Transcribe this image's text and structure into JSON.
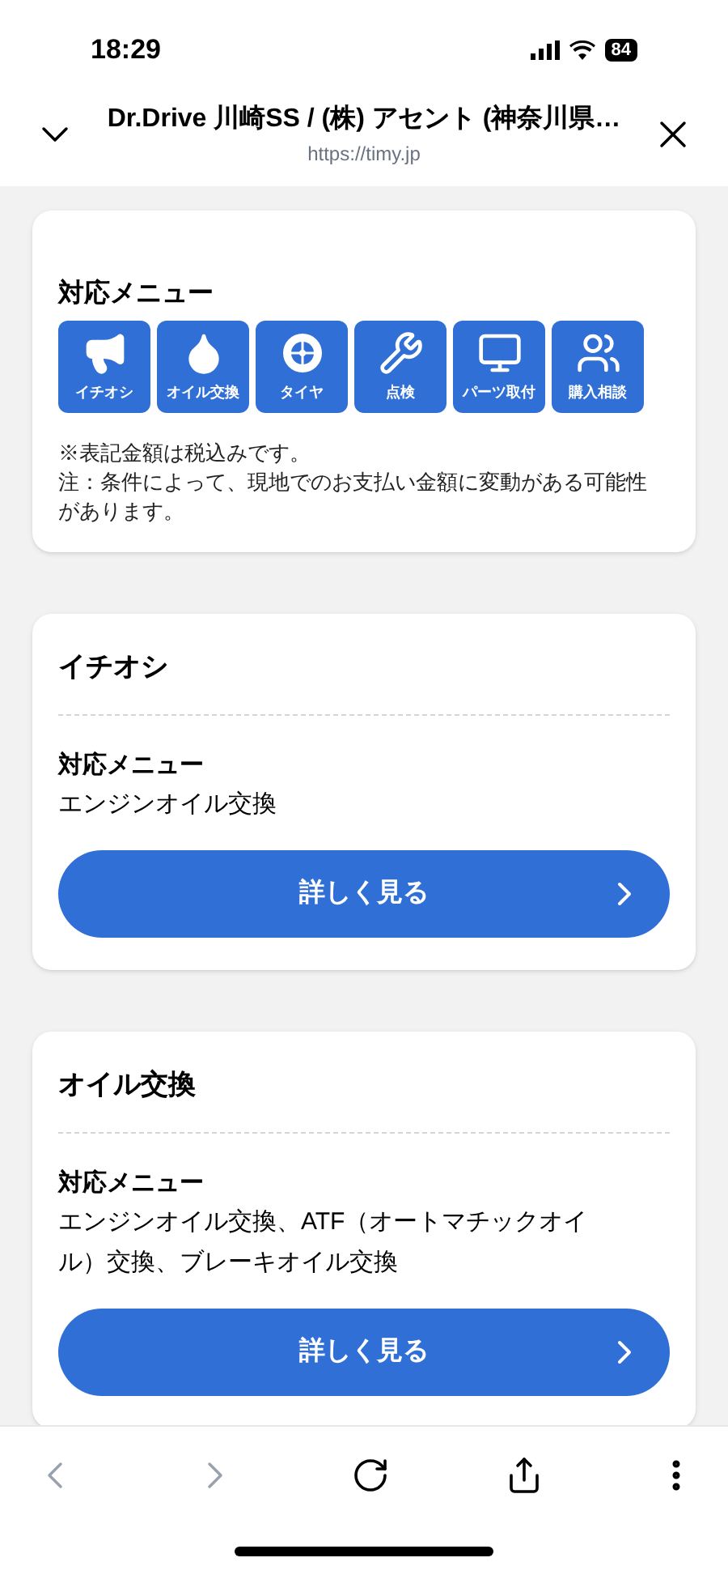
{
  "status_bar": {
    "time": "18:29",
    "battery": "84"
  },
  "header": {
    "title": "Dr.Drive 川崎SS / (株) アセント (神奈川県…",
    "url": "https://timy.jp"
  },
  "menu_card": {
    "heading": "対応メニュー",
    "items": [
      {
        "kind": "megaphone",
        "label": "イチオシ"
      },
      {
        "kind": "oil",
        "label": "オイル交換"
      },
      {
        "kind": "tire",
        "label": "タイヤ"
      },
      {
        "kind": "inspection",
        "label": "点検"
      },
      {
        "kind": "monitor",
        "label": "パーツ取付"
      },
      {
        "kind": "consult",
        "label": "購入相談"
      }
    ],
    "notes": [
      "※表記金額は税込みです。",
      "注：条件によって、現地でのお支払い金額に変動がある可能性があります。"
    ]
  },
  "sections": [
    {
      "title": "イチオシ",
      "menu_heading": "対応メニュー",
      "menu_text": "エンジンオイル交換",
      "button": "詳しく見る"
    },
    {
      "title": "オイル交換",
      "menu_heading": "対応メニュー",
      "menu_text": "エンジンオイル交換、ATF（オートマチックオイル）交換、ブレーキオイル交換",
      "button": "詳しく見る"
    }
  ],
  "toolbar": {
    "back_disabled": true,
    "forward_disabled": true
  }
}
